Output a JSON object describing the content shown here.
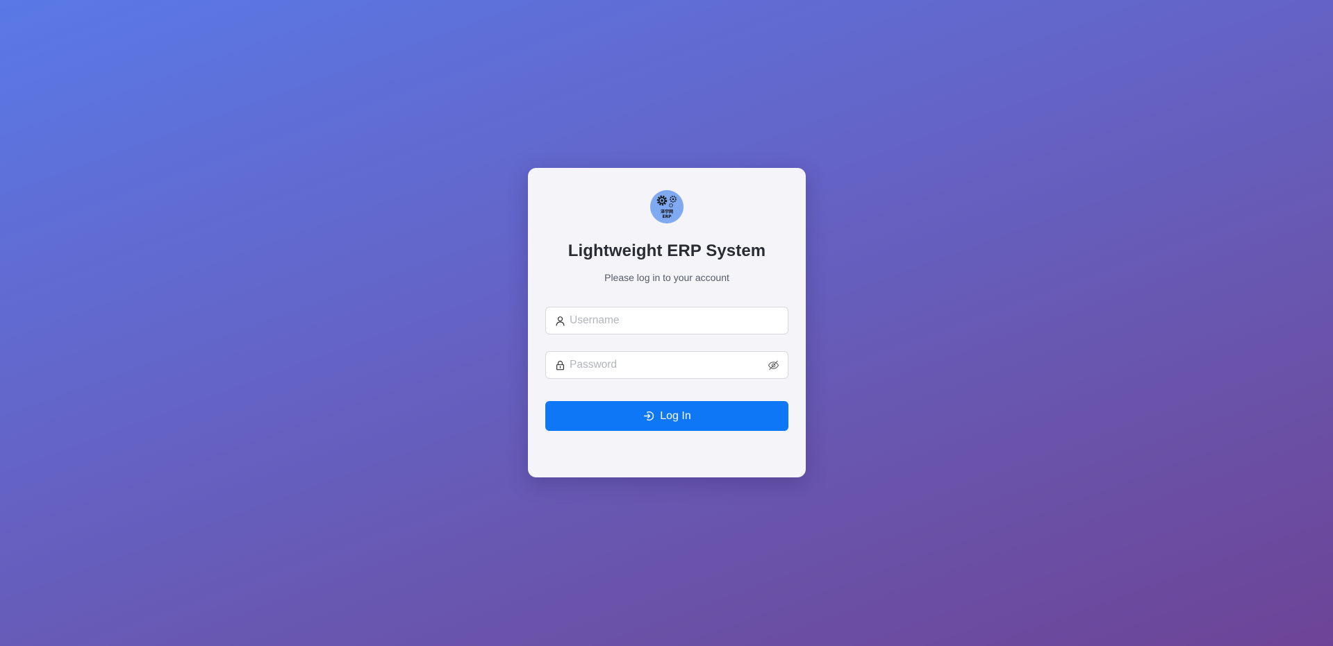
{
  "app": {
    "title": "Lightweight ERP System",
    "subtitle": "Please log in to your account",
    "logo_text_line1": "泽宇网",
    "logo_text_line2": "ERP"
  },
  "form": {
    "username": {
      "placeholder": "Username",
      "value": "",
      "icon": "user-icon"
    },
    "password": {
      "placeholder": "Password",
      "value": "",
      "icon": "lock-icon",
      "toggle_icon": "eye-hidden-icon"
    },
    "submit": {
      "label": "Log In",
      "icon": "login-icon"
    }
  },
  "colors": {
    "background_start": "#5a79e6",
    "background_end": "#6c4497",
    "card": "#f4f4f9",
    "primary_button": "#0d77f5",
    "logo_circle": "#7fa9f0"
  }
}
